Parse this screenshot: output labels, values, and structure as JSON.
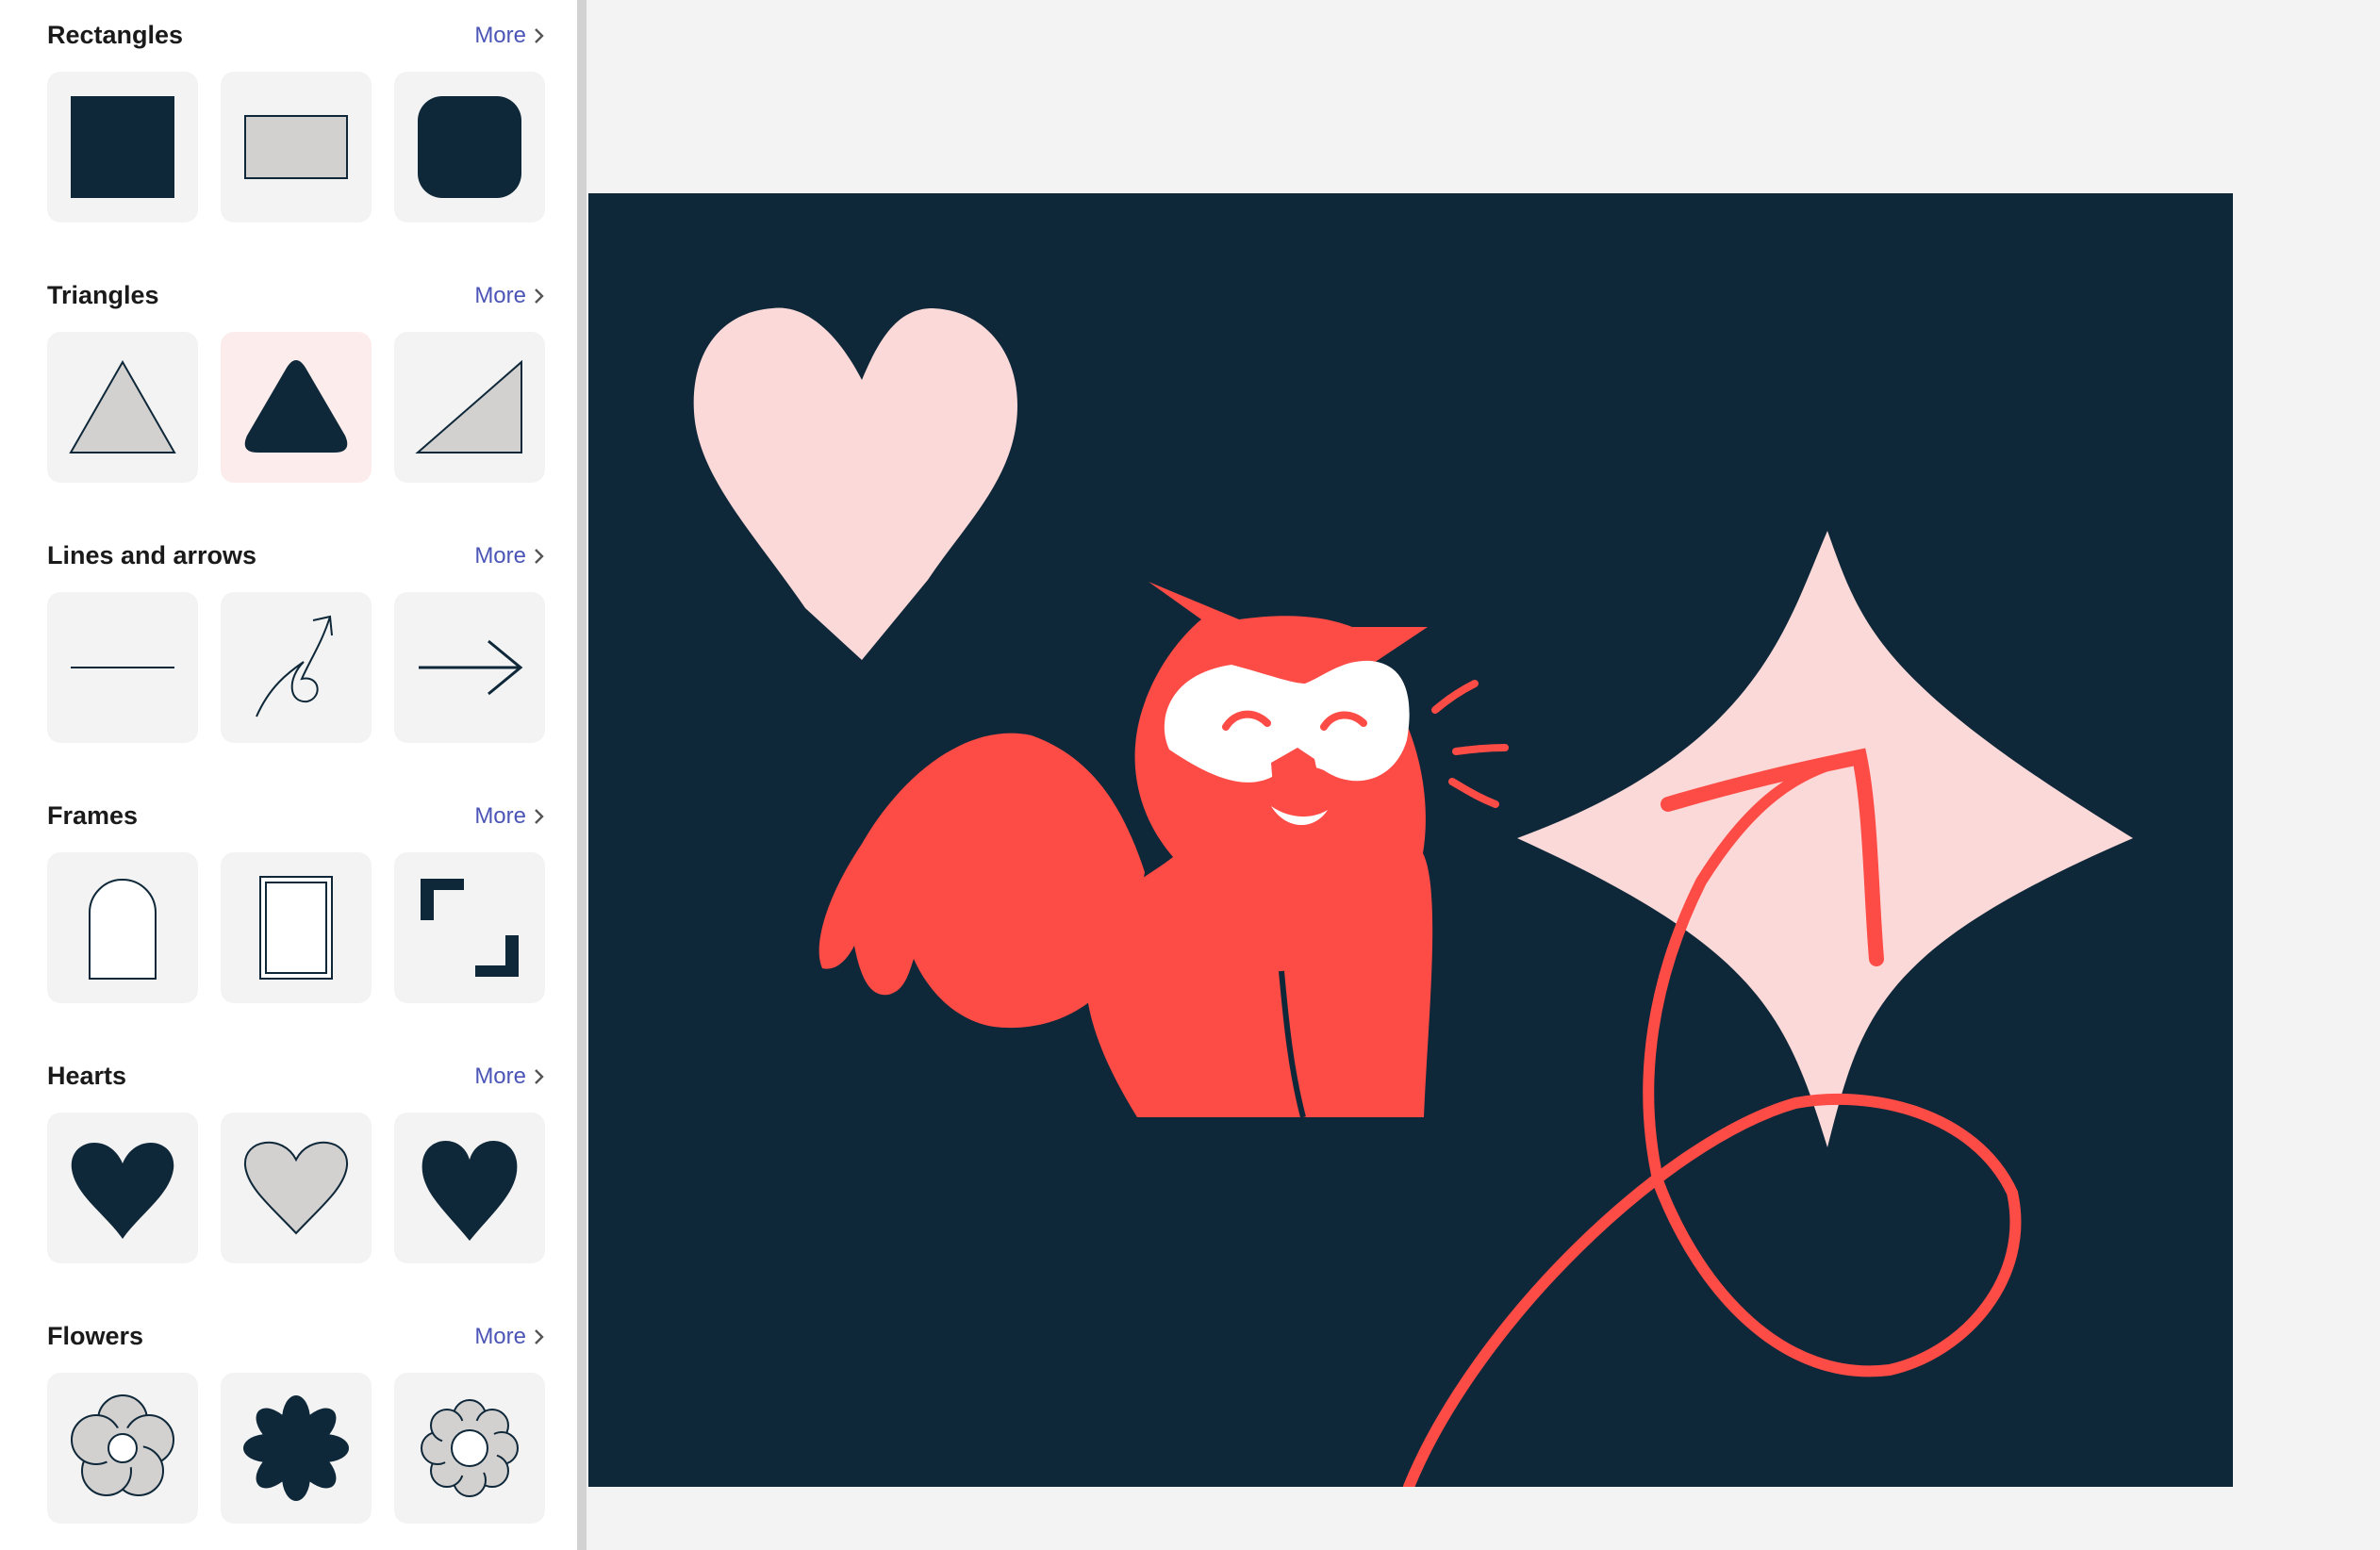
{
  "colors": {
    "accent": "#4b55b6",
    "dark_navy": "#0f2839",
    "coral": "#fd4b46",
    "pink": "#fbd9d8",
    "light_gray_fill": "#d3d0d0"
  },
  "panel": {
    "more_label": "More",
    "sections": [
      {
        "title": "Rectangles",
        "tiles": [
          "filled-square-icon",
          "outlined-rectangle-icon",
          "rounded-square-icon"
        ]
      },
      {
        "title": "Triangles",
        "tiles": [
          "outlined-triangle-icon",
          "rounded-triangle-icon",
          "right-triangle-icon"
        ]
      },
      {
        "title": "Lines and arrows",
        "tiles": [
          "straight-line-icon",
          "squiggle-arrow-icon",
          "arrow-right-icon"
        ]
      },
      {
        "title": "Frames",
        "tiles": [
          "arch-frame-icon",
          "double-rectangle-frame-icon",
          "corner-brackets-frame-icon"
        ]
      },
      {
        "title": "Hearts",
        "tiles": [
          "filled-heart-icon",
          "outlined-heart-icon",
          "tall-heart-icon"
        ]
      },
      {
        "title": "Flowers",
        "tiles": [
          "five-petal-flower-icon",
          "eight-petal-flower-icon",
          "scalloped-flower-icon"
        ]
      }
    ],
    "selected_tile": "rounded-triangle-icon"
  },
  "canvas": {
    "elements": [
      "pink-heart-shape",
      "owl-illustration",
      "pink-four-point-star-shape",
      "coral-squiggle-arrow"
    ]
  }
}
